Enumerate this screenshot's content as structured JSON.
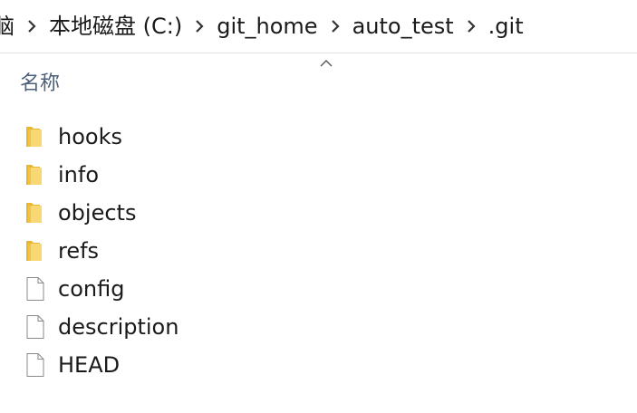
{
  "breadcrumb": {
    "items": [
      {
        "label": "脑"
      },
      {
        "label": "本地磁盘 (C:)"
      },
      {
        "label": "git_home"
      },
      {
        "label": "auto_test"
      },
      {
        "label": ".git"
      }
    ]
  },
  "column_header": {
    "name_label": "名称",
    "sort": "ascending"
  },
  "files": [
    {
      "name": "hooks",
      "type": "folder"
    },
    {
      "name": "info",
      "type": "folder"
    },
    {
      "name": "objects",
      "type": "folder"
    },
    {
      "name": "refs",
      "type": "folder"
    },
    {
      "name": "config",
      "type": "file"
    },
    {
      "name": "description",
      "type": "file"
    },
    {
      "name": "HEAD",
      "type": "file"
    }
  ],
  "colors": {
    "folder_yellow": "#f8d775",
    "folder_dark": "#e8b730",
    "header_text": "#4c607a",
    "separator": "#e3e3e3"
  }
}
